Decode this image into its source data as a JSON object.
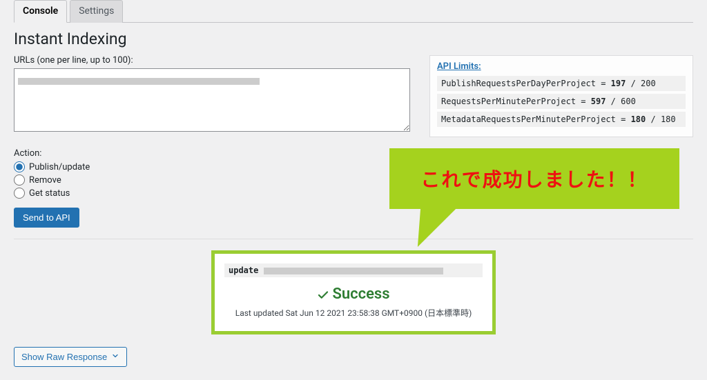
{
  "tabs": {
    "console": "Console",
    "settings": "Settings"
  },
  "page_title": "Instant Indexing",
  "urls_label": "URLs (one per line, up to 100):",
  "api_limits": {
    "title": "API Limits:",
    "rows": [
      {
        "name": "PublishRequestsPerDayPerProject",
        "current": "197",
        "max": "200"
      },
      {
        "name": "RequestsPerMinutePerProject",
        "current": "597",
        "max": "600"
      },
      {
        "name": "MetadataRequestsPerMinutePerProject",
        "current": "180",
        "max": "180"
      }
    ]
  },
  "action": {
    "label": "Action:",
    "options": {
      "publish": "Publish/update",
      "remove": "Remove",
      "get_status": "Get status"
    },
    "send_button": "Send to API"
  },
  "callout_text": "これで成功しました！！",
  "result": {
    "code_prefix": "update",
    "success_label": "Success",
    "last_updated": "Last updated Sat Jun 12 2021 23:58:38 GMT+0900 (日本標準時)"
  },
  "raw_response_button": "Show Raw Response"
}
